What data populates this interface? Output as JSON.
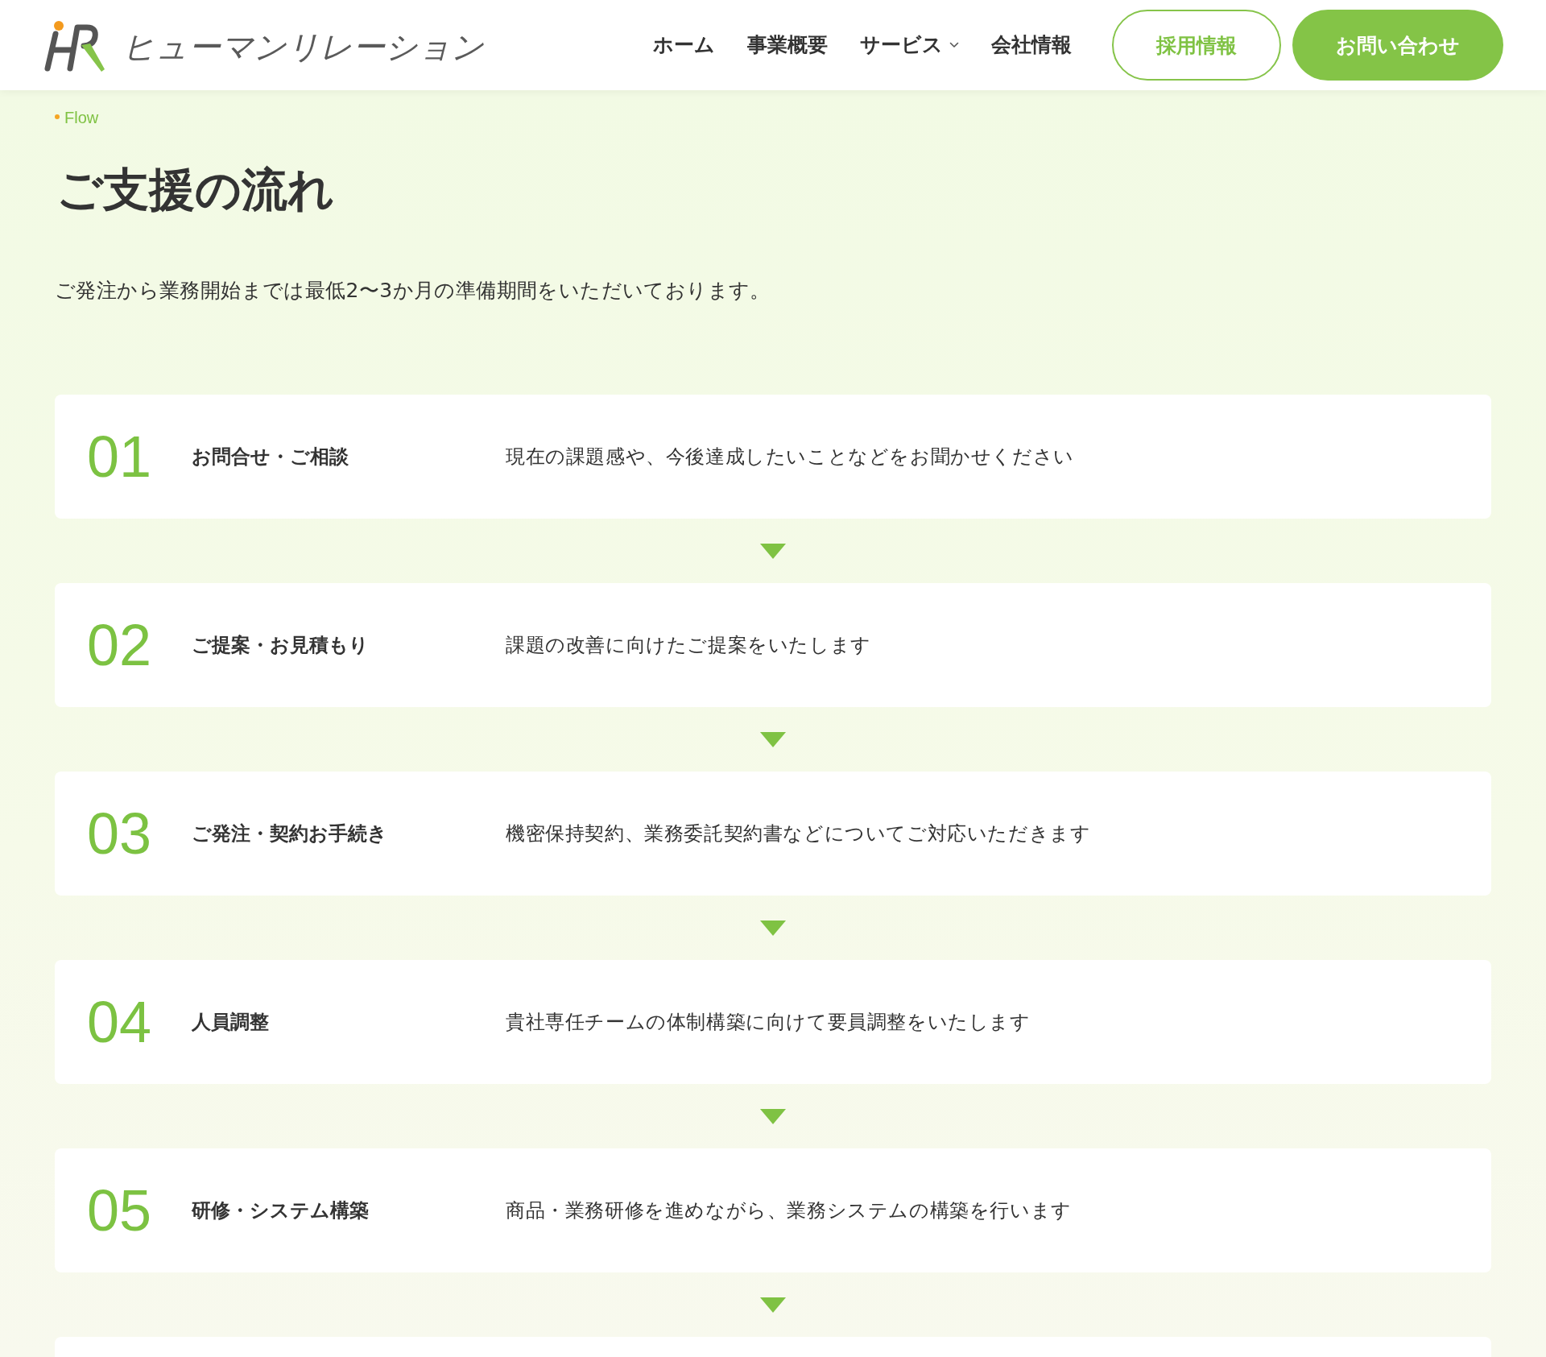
{
  "header": {
    "logo": {
      "text": "ヒューマンリレーション"
    },
    "nav": [
      {
        "label": "ホーム",
        "has_dropdown": false
      },
      {
        "label": "事業概要",
        "has_dropdown": false
      },
      {
        "label": "サービス",
        "has_dropdown": true
      },
      {
        "label": "会社情報",
        "has_dropdown": false
      }
    ],
    "buttons": [
      {
        "label": "採用情報",
        "kind": "outline"
      },
      {
        "label": "お問い合わせ",
        "kind": "filled"
      }
    ]
  },
  "section_label": "Flow",
  "page": {
    "title": "ご支援の流れ",
    "intro": "ご発注から業務開始までは最低2〜3か月の準備期間をいただいております。"
  },
  "steps": [
    {
      "number": "01",
      "title": "お問合せ・ご相談",
      "description": "現在の課題感や、今後達成したいことなどをお聞かせください"
    },
    {
      "number": "02",
      "title": "ご提案・お見積もり",
      "description": "課題の改善に向けたご提案をいたします"
    },
    {
      "number": "03",
      "title": "ご発注・契約お手続き",
      "description": "機密保持契約、業務委託契約書などについてご対応いただきます"
    },
    {
      "number": "04",
      "title": "人員調整",
      "description": "貴社専任チームの体制構築に向けて要員調整をいたします"
    },
    {
      "number": "05",
      "title": "研修・システム構築",
      "description": "商品・業務研修を進めながら、業務システムの構築を行います"
    }
  ],
  "flow": {
    "continues": true
  }
}
